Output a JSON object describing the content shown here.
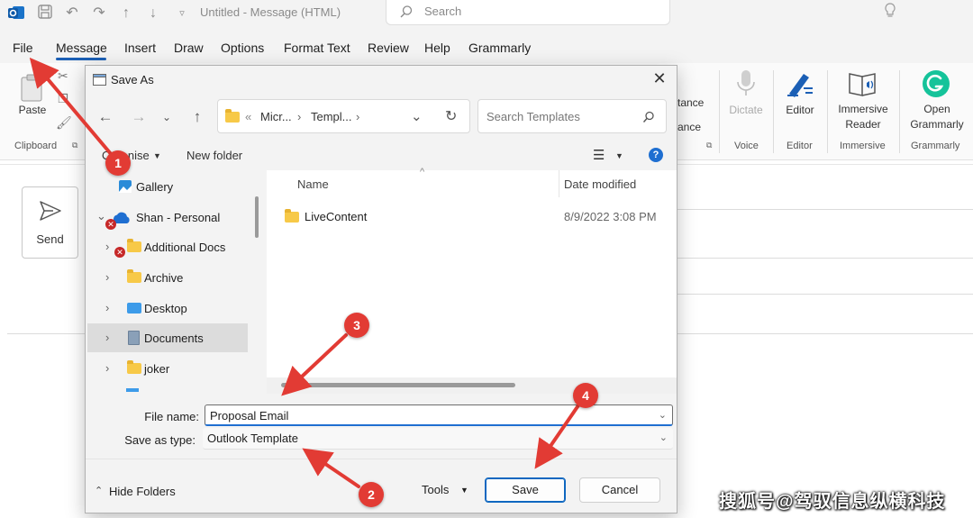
{
  "app": {
    "title": "Untitled - Message (HTML)",
    "search_placeholder": "Search"
  },
  "menu": {
    "items": [
      "File",
      "Message",
      "Insert",
      "Draw",
      "Options",
      "Format Text",
      "Review",
      "Help",
      "Grammarly"
    ],
    "active": "Message"
  },
  "ribbon": {
    "paste_label": "Paste",
    "clipboard_group": "Clipboard",
    "partial_text_1": "tance",
    "partial_text_2": "ance",
    "dictate_label": "Dictate",
    "voice_group": "Voice",
    "editor_label": "Editor",
    "editor_group": "Editor",
    "immersive_label_1": "Immersive",
    "immersive_label_2": "Reader",
    "immersive_group": "Immersive",
    "grammarly_label_1": "Open",
    "grammarly_label_2": "Grammarly",
    "grammarly_group": "Grammarly",
    "grammarly_color": "#15c39a"
  },
  "compose": {
    "send_label": "Send"
  },
  "dialog": {
    "title": "Save As",
    "close_glyph": "✕",
    "address": {
      "prefix": "«",
      "segments": [
        "Micr...",
        "Templ..."
      ],
      "separator": "›"
    },
    "search_placeholder": "Search Templates",
    "commands": {
      "organize": "Organise",
      "new_folder": "New folder"
    },
    "nav": [
      {
        "label": "Gallery"
      },
      {
        "label": "Shan - Personal"
      },
      {
        "label": "Additional Docs"
      },
      {
        "label": "Archive"
      },
      {
        "label": "Desktop"
      },
      {
        "label": "Documents"
      },
      {
        "label": "joker"
      }
    ],
    "columns": {
      "name": "Name",
      "date_modified": "Date modified"
    },
    "files": [
      {
        "name": "LiveContent",
        "date": "8/9/2022 3:08 PM"
      }
    ],
    "form": {
      "file_name_label": "File name:",
      "file_name_value": "Proposal Email",
      "save_type_label": "Save as type:",
      "save_type_value": "Outlook Template"
    },
    "footer": {
      "hide_folders": "Hide Folders",
      "tools": "Tools",
      "save": "Save",
      "cancel": "Cancel"
    }
  },
  "annotations": {
    "badges": [
      "1",
      "2",
      "3",
      "4"
    ],
    "color": "#e23b34"
  },
  "watermark": "搜狐号@驾驭信息纵横科技"
}
